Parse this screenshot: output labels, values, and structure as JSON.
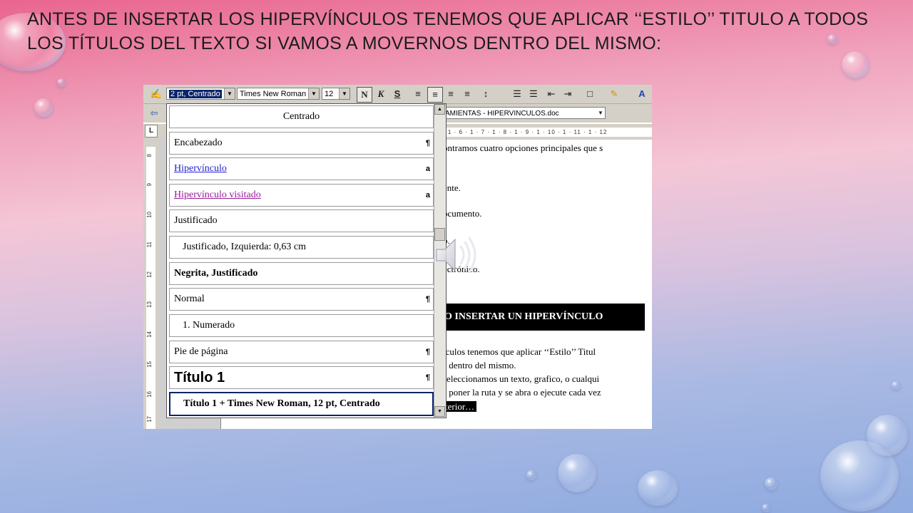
{
  "slide": {
    "title": "ANTES DE INSERTAR LOS HIPERVÍNCULOS TENEMOS QUE APLICAR ‘‘ESTILO’’ TITULO A TODOS LOS TÍTULOS DEL TEXTO SI VAMOS A MOVERNOS DENTRO DEL MISMO:"
  },
  "toolbar": {
    "style_value": "2 pt, Centrado",
    "font_value": "Times New Roman",
    "size_value": "12",
    "bold_label": "N",
    "italic_label": "K",
    "underline_label": "S",
    "font_color_label": "A"
  },
  "document_bar": {
    "doc_name": "AMIENTAS - HIPERVINCULOS.doc"
  },
  "ruler": {
    "text": "· 1 · 6 · 1 · 7 · 1 · 8 · 1 · 9 · 1 · 10 · 1 · 11 · 1 · 12",
    "corner_label": "L"
  },
  "vruler": [
    "8",
    "9",
    "10",
    "11",
    "12",
    "13",
    "14",
    "15",
    "16",
    "17"
  ],
  "style_dropdown": {
    "items": [
      {
        "label": "Centrado",
        "mark": ""
      },
      {
        "label": "Encabezado",
        "mark": "¶"
      },
      {
        "label": "Hipervínculo",
        "mark": "a"
      },
      {
        "label": "Hipervínculo visitado",
        "mark": "a"
      },
      {
        "label": "Justificado",
        "mark": ""
      },
      {
        "label": "Justificado, Izquierda:  0,63 cm",
        "mark": ""
      },
      {
        "label": "Negrita, Justificado",
        "mark": ""
      },
      {
        "label": "Normal",
        "mark": "¶"
      },
      {
        "label": "1.  Numerado",
        "mark": ""
      },
      {
        "label": "Pie de página",
        "mark": "¶"
      },
      {
        "label": "Título 1",
        "mark": "¶"
      },
      {
        "label": "Título 1 + Times New Roman, 12 pt, Centrado",
        "mark": ""
      }
    ]
  },
  "document": {
    "line1": "ontramos cuatro opciones principales que s",
    "line2": "ente.",
    "line3": "ocumento.",
    "line4": "o.",
    "line5": "ectrónico.",
    "heading": "O INSERTAR UN HIPERVÍNCULO",
    "p1": "ículos tenemos que aplicar ‘‘Estilo’’ Titul",
    "p2": "s dentro del mismo.",
    "p3": "seleccionamos un texto, grafico, o cualqui",
    "p4": "s poner la ruta y se abra o ejecute cada vez",
    "p5": "terior…"
  }
}
